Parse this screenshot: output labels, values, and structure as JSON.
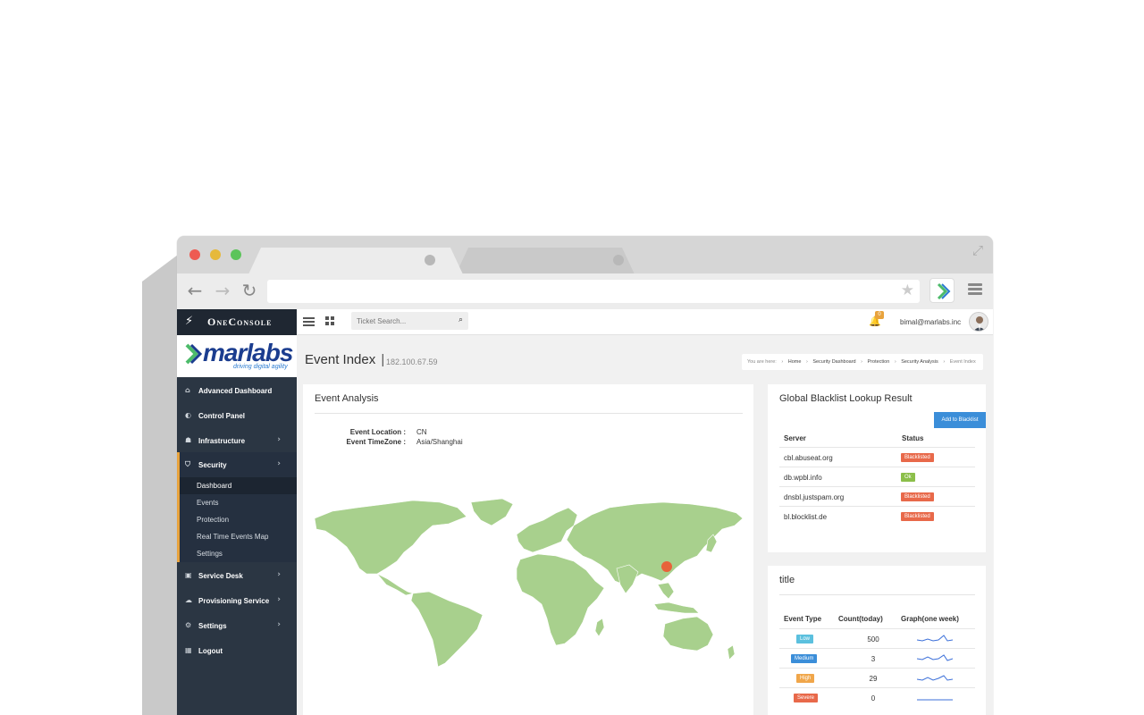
{
  "app": {
    "brand": "OneConsole",
    "logo_text": "marlabs",
    "logo_tagline": "driving digital agility"
  },
  "topbar": {
    "search_placeholder": "Ticket Search...",
    "notification_count": "0",
    "user_email": "bimal@marlabs.inc"
  },
  "sidebar": {
    "items": [
      {
        "label": "Advanced Dashboard",
        "icon": "home-icon"
      },
      {
        "label": "Control Panel",
        "icon": "toggle-icon"
      },
      {
        "label": "Infrastructure",
        "icon": "sitemap-icon"
      },
      {
        "label": "Security",
        "icon": "shield-icon"
      },
      {
        "label": "Service Desk",
        "icon": "briefcase-icon"
      },
      {
        "label": "Provisioning Service",
        "icon": "cloud-icon"
      },
      {
        "label": "Settings",
        "icon": "gears-icon"
      },
      {
        "label": "Logout",
        "icon": "calendar-icon"
      }
    ],
    "security_submenu": [
      "Dashboard",
      "Events",
      "Protection",
      "Real Time Events Map",
      "Settings"
    ]
  },
  "page": {
    "title": "Event Index",
    "separator": "|",
    "subtitle": "182.100.67.59"
  },
  "breadcrumb": {
    "prefix": "You are here:",
    "items": [
      "Home",
      "Security Dashboard",
      "Protection",
      "Security Analysis",
      "Event Index"
    ]
  },
  "event_analysis": {
    "title": "Event Analysis",
    "location_label": "Event Location :",
    "location_value": "CN",
    "timezone_label": "Event TimeZone :",
    "timezone_value": "Asia/Shanghai",
    "map_land_color": "#a8d08d",
    "marker_color": "#e8623a"
  },
  "blacklist": {
    "title": "Global Blacklist Lookup Result",
    "add_button": "Add to Blacklist",
    "headers": [
      "Server",
      "Status"
    ],
    "rows": [
      {
        "server": "cbl.abuseat.org",
        "status": "Blacklisted",
        "color": "#e8694a"
      },
      {
        "server": "db.wpbl.info",
        "status": "Ok",
        "color": "#8cbf4a"
      },
      {
        "server": "dnsbl.justspam.org",
        "status": "Blacklisted",
        "color": "#e8694a"
      },
      {
        "server": "bl.blocklist.de",
        "status": "Blacklisted",
        "color": "#e8694a"
      }
    ]
  },
  "event_table": {
    "title": "title",
    "headers": [
      "Event Type",
      "Count(today)",
      "Graph(one week)"
    ],
    "rows": [
      {
        "type": "Low",
        "count": "500",
        "color": "#5bc0de"
      },
      {
        "type": "Medium",
        "count": "3",
        "color": "#3b8ed9"
      },
      {
        "type": "High",
        "count": "29",
        "color": "#f0a64a"
      },
      {
        "type": "Severe",
        "count": "0",
        "color": "#e8694a"
      }
    ]
  }
}
